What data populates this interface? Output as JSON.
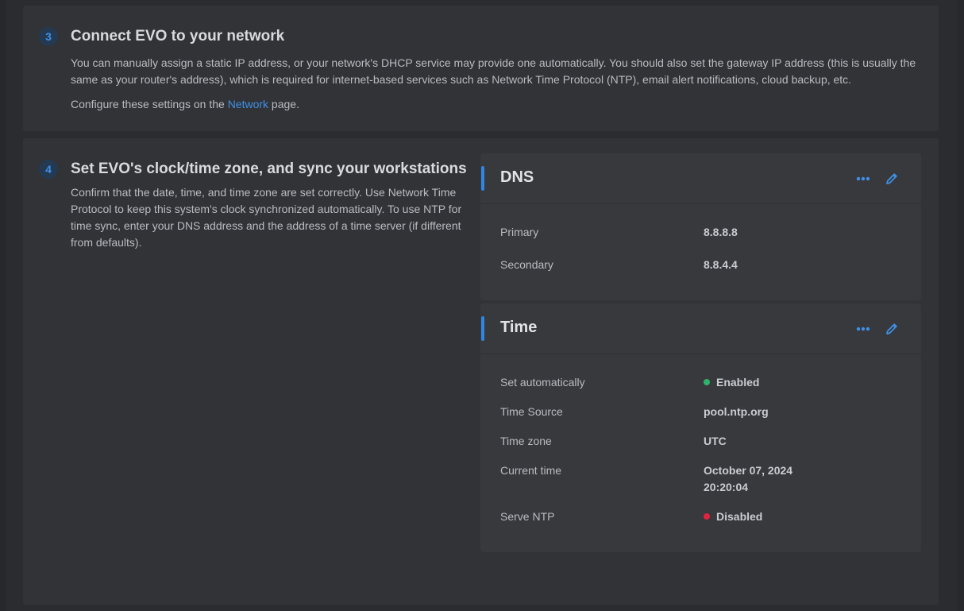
{
  "step3": {
    "number": "3",
    "title": "Connect EVO to your network",
    "body": "You can manually assign a static IP address, or your network's DHCP service may provide one automatically. You should also set the gateway IP address (this is usually the same as your router's address), which is required for internet-based services such as Network Time Protocol (NTP), email alert notifications, cloud backup, etc.",
    "configure_prefix": "Configure these settings on the ",
    "configure_link": "Network",
    "configure_suffix": " page."
  },
  "step4": {
    "number": "4",
    "title": "Set EVO's clock/time zone, and sync your workstations",
    "body": "Confirm that the date, time, and time zone are set correctly. Use Network Time Protocol to keep this system's clock synchronized automatically. To use NTP for time sync, enter your DNS address and the address of a time server (if different from defaults)."
  },
  "dns": {
    "title": "DNS",
    "primary_label": "Primary",
    "primary_value": "8.8.8.8",
    "secondary_label": "Secondary",
    "secondary_value": "8.8.4.4"
  },
  "time": {
    "title": "Time",
    "set_auto_label": "Set automatically",
    "set_auto_value": "Enabled",
    "source_label": "Time Source",
    "source_value": "pool.ntp.org",
    "zone_label": "Time zone",
    "zone_value": "UTC",
    "current_label": "Current time",
    "current_date": "October 07, 2024",
    "current_clock": "20:20:04",
    "serve_label": "Serve NTP",
    "serve_value": "Disabled"
  },
  "colors": {
    "accent": "#2f86e4",
    "enabled": "#2fb36b",
    "disabled": "#e0233f"
  },
  "icons": {
    "more": "more-horizontal-icon",
    "edit": "pencil-icon"
  }
}
